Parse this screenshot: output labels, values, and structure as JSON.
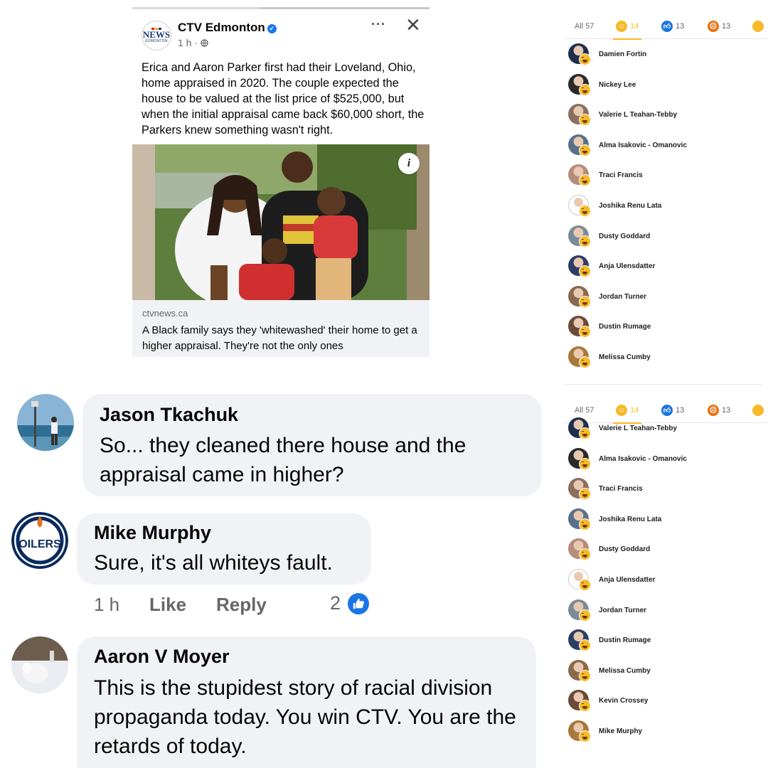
{
  "post": {
    "page_name": "CTV Edmonton",
    "logo_text": "NEWS",
    "logo_subtext": "EDMONTON",
    "time": "1 h · ",
    "more": "···",
    "close": "✕",
    "body": "Erica and Aaron Parker first had their Loveland, Ohio, home appraised in 2020. The couple expected the house to be valued at the list price of $525,000, but when the initial appraisal came back $60,000 short, the Parkers knew something wasn't right.",
    "info": "i",
    "link_domain": "ctvnews.ca",
    "link_title": "A Black family says they 'whitewashed' their home to get a higher appraisal. They're not the only ones"
  },
  "comments": [
    {
      "author": "Jason Tkachuk",
      "text": "So... they cleaned there house and the appraisal came in higher?"
    },
    {
      "author": "Mike Murphy",
      "text": "Sure, it's all whiteys fault."
    },
    {
      "author": "Aaron V Moyer",
      "text": "This is the stupidest story of racial division propaganda today. You win CTV. You are the retards of today."
    }
  ],
  "comment_actions": {
    "time": "1 h",
    "like": "Like",
    "reply": "Reply",
    "like_count": "2"
  },
  "oilers_logo_text": "OILERS",
  "reaction_tabs": {
    "all": "All 57",
    "haha": "14",
    "like": "13",
    "angry": "13"
  },
  "reactions_panel_1": [
    "Damien Fortin",
    "Nickey Lee",
    "Valerie L Teahan-Tebby",
    "Alma Isakovic - Omanovic",
    "Traci Francis",
    "Joshika Renu Lata",
    "Dusty Goddard",
    "Anja Ulensdatter",
    "Jordan Turner",
    "Dustin Rumage",
    "Melissa Cumby"
  ],
  "reactions_panel_2": [
    "Valerie L Teahan-Tebby",
    "Alma Isakovic - Omanovic",
    "Traci Francis",
    "Joshika Renu Lata",
    "Dusty Goddard",
    "Anja Ulensdatter",
    "Jordan Turner",
    "Dustin Rumage",
    "Melissa Cumby",
    "Kevin Crossey",
    "Mike Murphy"
  ],
  "colors": {
    "facebook_blue": "#1877f2",
    "bubble_gray": "#f0f2f5",
    "haha_yellow": "#f7b928",
    "angry_orange": "#e9710f"
  }
}
